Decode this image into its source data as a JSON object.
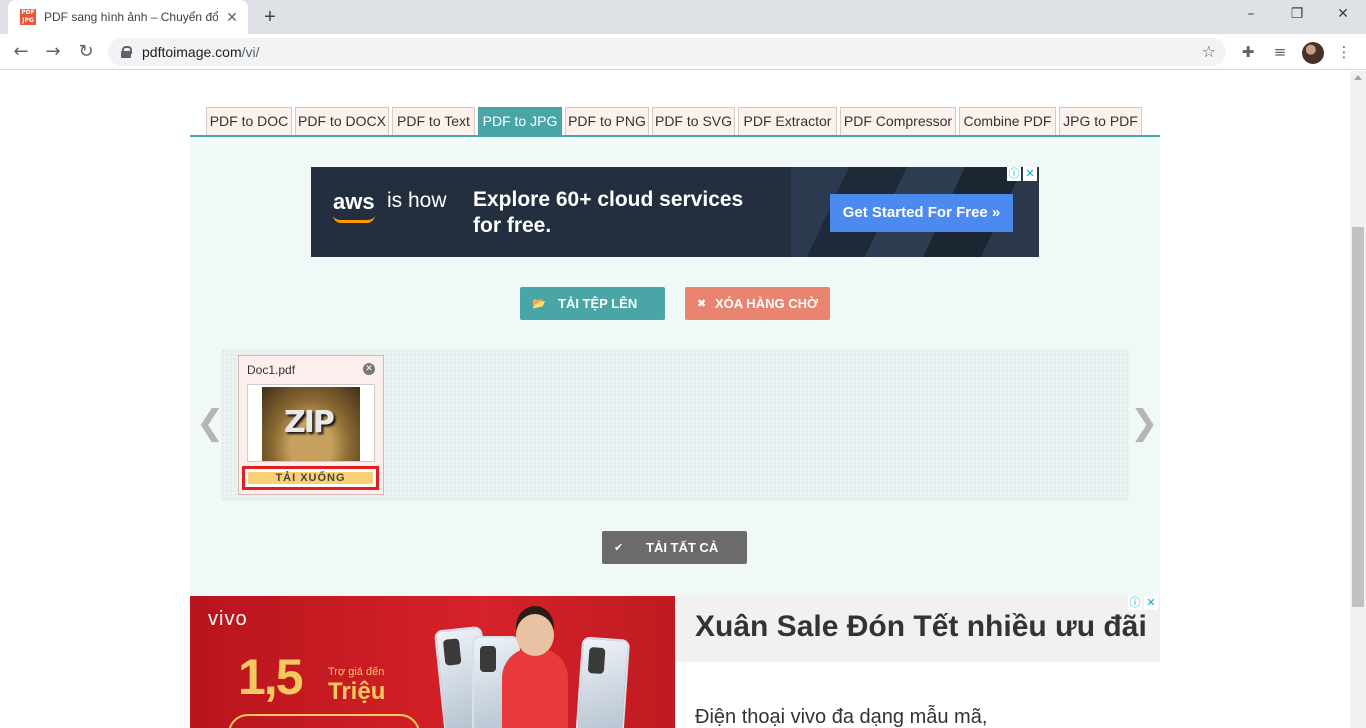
{
  "browser": {
    "tab_title": "PDF sang hình ảnh – Chuyển đổi",
    "url_host": "pdftoimage.com",
    "url_path": "/vi/"
  },
  "nav_tabs": [
    {
      "label": "PDF to DOC",
      "active": false
    },
    {
      "label": "PDF to DOCX",
      "active": false
    },
    {
      "label": "PDF to Text",
      "active": false
    },
    {
      "label": "PDF to JPG",
      "active": true
    },
    {
      "label": "PDF to PNG",
      "active": false
    },
    {
      "label": "PDF to SVG",
      "active": false
    },
    {
      "label": "PDF Extractor",
      "active": false
    },
    {
      "label": "PDF Compressor",
      "active": false
    },
    {
      "label": "Combine PDF",
      "active": false
    },
    {
      "label": "JPG to PDF",
      "active": false
    }
  ],
  "aws_ad": {
    "logo": "aws",
    "tagline": "is how",
    "headline": "Explore 60+ cloud services for free.",
    "cta": "Get Started For Free »"
  },
  "actions": {
    "upload": "TẢI TỆP LÊN",
    "clear": "XÓA HÀNG CHỜ",
    "download_all": "TẢI TẤT CẢ"
  },
  "queue": {
    "prev_arrow": "❮",
    "next_arrow": "❯",
    "files": [
      {
        "name": "Doc1.pdf",
        "thumb_text": "ZIP",
        "download_label": "TẢI XUỐNG"
      }
    ]
  },
  "vivo_ad": {
    "brand": "vivo",
    "amount": "1,5",
    "small_text": "Trợ giá đến",
    "unit": "Triệu",
    "title": "Xuân Sale Đón Tết nhiều ưu đãi",
    "description": "Điện thoại vivo đa dạng mẫu mã,"
  },
  "colors": {
    "accent": "#4aa6a6",
    "clear_button": "#e8846f",
    "download_all_button": "#6b6b6b",
    "download_highlight": "#e02020"
  }
}
